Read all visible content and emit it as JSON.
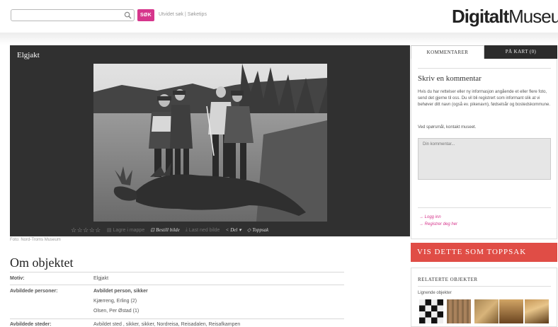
{
  "header": {
    "search_placeholder": "",
    "search_button": "SØK",
    "links_text": "Utvidet søk | Søketips",
    "logo_bold": "Digitalt",
    "logo_regular": "Museum"
  },
  "viewer": {
    "title": "Elgjakt",
    "stars": "☆☆☆☆☆",
    "toolbar": {
      "lagre": "Lagre i mappe",
      "bestill": "Bestill bilde",
      "last_ned": "Last ned bilde",
      "del": "Del",
      "toppsak": "Toppsak"
    },
    "credit": "Foto: Nord-Troms Museum"
  },
  "object": {
    "heading": "Om objektet",
    "fields": [
      {
        "label": "Motiv:",
        "values": [
          "Elgjakt"
        ]
      },
      {
        "label": "Avbildede personer:",
        "values": [
          "Avbildet person, sikker",
          "Kjærreng, Erling (2)",
          "Olsen, Per Østad (1)"
        ]
      },
      {
        "label": "Avbildede steder:",
        "values": [
          "Avbildet sted , sikker, sikker, Nordreisa, Reisadalen, Reisafkampen"
        ]
      }
    ]
  },
  "sidebar": {
    "tabs": [
      "KOMMENTARER",
      "PÅ KART (0)"
    ],
    "comment_title": "Skriv en kommentar",
    "comment_text": "Hvis du har rettelser eller ny informasjon angående et eller flere foto, send det gjerne til oss. Du vil bli registrert som informant slik at vi behøver ditt navn (også ev. pikenavn), fødselsår og bostedskommune.",
    "comment_text2": "Ved spørsmål, kontakt museet.",
    "comment_placeholder": "Din kommentar...",
    "login": "→ Logg inn",
    "register": "→ Registrer deg her",
    "toppsak_button": "VIS DETTE SOM TOPPSAK",
    "related_title": "RELATERTE OBJEKTER",
    "related_sub": "Lignende objekter"
  }
}
